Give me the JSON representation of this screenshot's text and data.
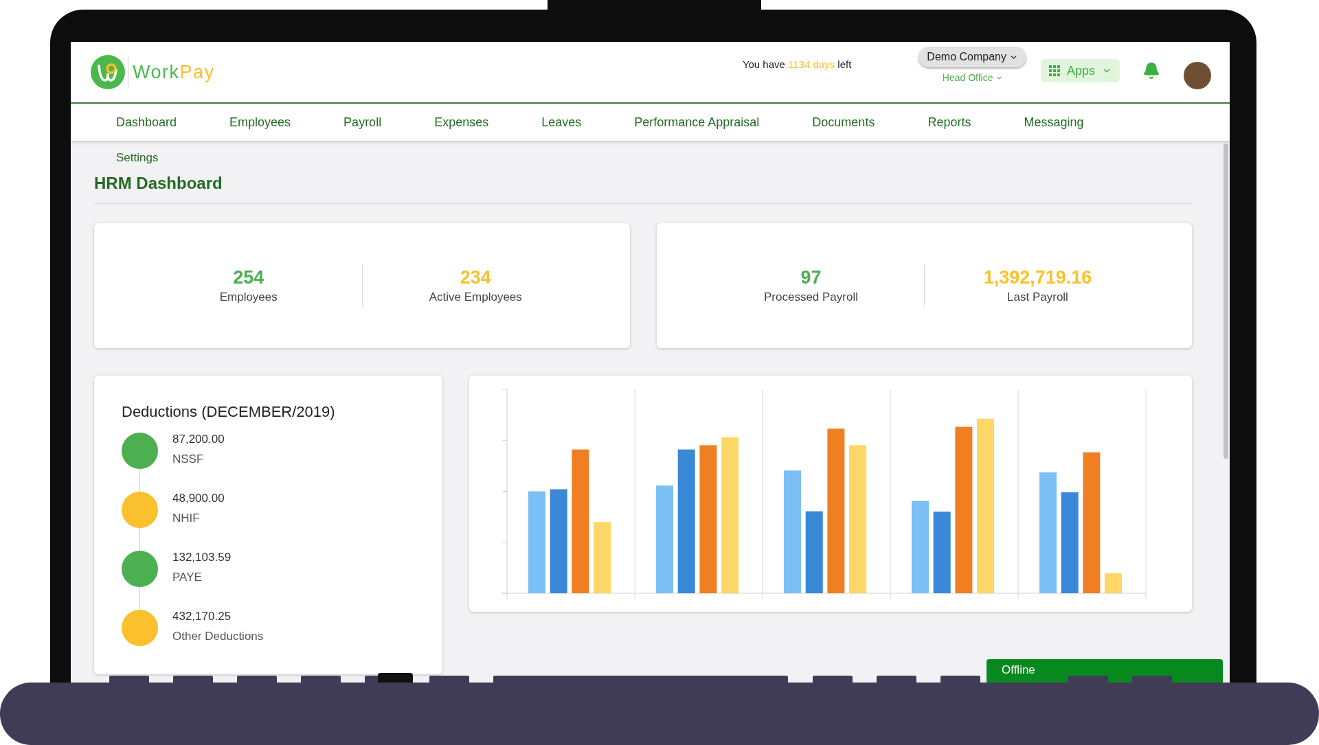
{
  "logo": {
    "parts": [
      {
        "text": "Work",
        "kind": "primary"
      },
      {
        "text": "Pay",
        "kind": "accent"
      }
    ]
  },
  "trial_notice": {
    "before": "You have",
    "highlight": "1134 days",
    "after": "left"
  },
  "company_switcher": {
    "company": "Demo Company",
    "branch": "Head Office"
  },
  "apps_button": {
    "label": "Apps"
  },
  "nav": [
    "Dashboard",
    "Employees",
    "Payroll",
    "Expenses",
    "Leaves",
    "Performance Appraisal",
    "Documents",
    "Reports",
    "Messaging"
  ],
  "subnav": [
    "Settings"
  ],
  "page_title": "HRM Dashboard",
  "stat_cards": [
    {
      "stats": [
        {
          "value": "254",
          "label": "Employees",
          "color": "#4caf50"
        },
        {
          "value": "234",
          "label": "Active Employees",
          "color": "#fbc02d"
        }
      ]
    },
    {
      "stats": [
        {
          "value": "97",
          "label": "Processed Payroll",
          "color": "#4caf50"
        },
        {
          "value": "1,392,719.16",
          "label": "Last Payroll",
          "color": "#fbc02d"
        }
      ]
    }
  ],
  "deductions": {
    "title": "Deductions (DECEMBER/2019)",
    "items": [
      {
        "amount": "87,200.00",
        "name": "NSSF",
        "color": "#4caf50"
      },
      {
        "amount": "48,900.00",
        "name": "NHIF",
        "color": "#fbc02d"
      },
      {
        "amount": "132,103.59",
        "name": "PAYE",
        "color": "#4caf50"
      },
      {
        "amount": "432,170.25",
        "name": "Other Deductions",
        "color": "#fbc02d"
      }
    ]
  },
  "toast": {
    "text": "Offline"
  }
}
